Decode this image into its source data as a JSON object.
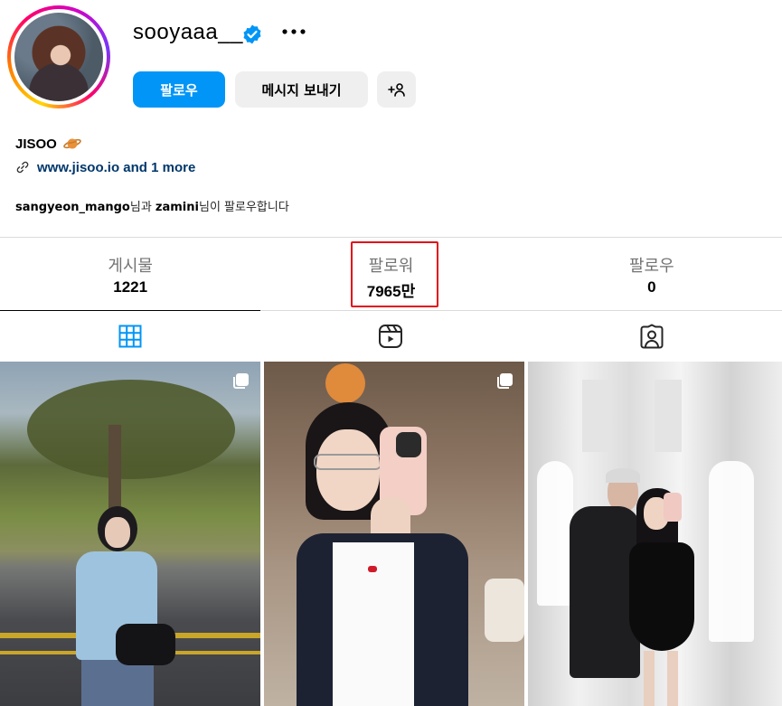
{
  "profile": {
    "username": "sooyaaa__",
    "display_name": "JISOO",
    "link_text": "www.jisoo.io and 1 more",
    "followed_by": {
      "user1": "sangyeon_mango",
      "joiner": "님과 ",
      "user2": "zamini",
      "suffix": "님이 팔로우합니다"
    }
  },
  "actions": {
    "follow_label": "팔로우",
    "message_label": "메시지 보내기"
  },
  "stats": {
    "posts_label": "게시물",
    "posts_value": "1221",
    "followers_label": "팔로워",
    "followers_value": "7965만",
    "following_label": "팔로우",
    "following_value": "0"
  },
  "tabs": [
    {
      "name": "posts",
      "icon": "grid-icon",
      "active": true
    },
    {
      "name": "reels",
      "icon": "reels-icon",
      "active": false
    },
    {
      "name": "tagged",
      "icon": "tagged-icon",
      "active": false
    }
  ],
  "colors": {
    "accent": "#0095f6",
    "highlight": "#e0101a",
    "link": "#00376b"
  }
}
